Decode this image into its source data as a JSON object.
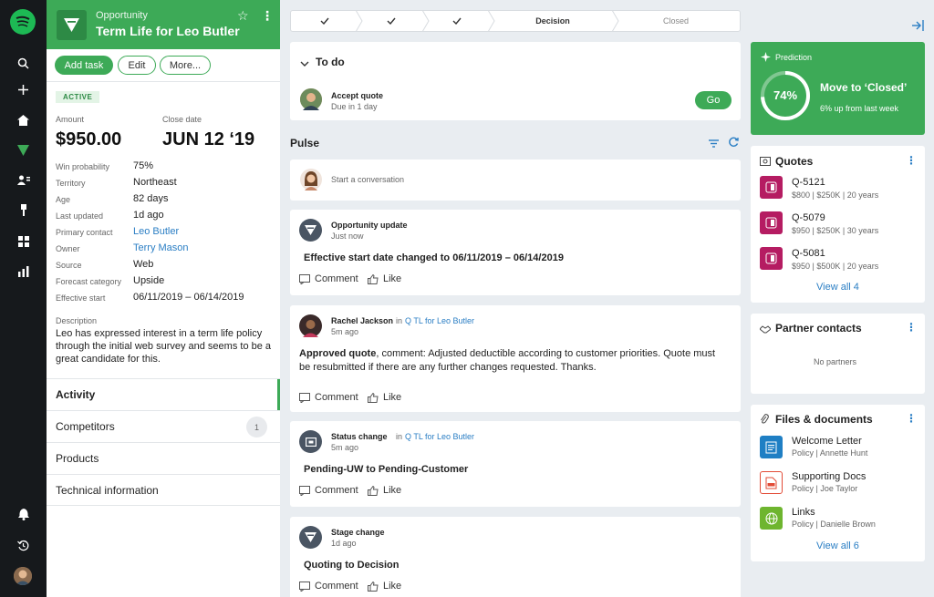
{
  "rail": {
    "icons": [
      "spotify-logo-icon",
      "search-icon",
      "plus-icon",
      "home-icon",
      "funnel-icon",
      "contacts-icon",
      "pin-icon",
      "grid-icon",
      "bar-chart-icon",
      "bell-icon",
      "history-icon"
    ]
  },
  "opportunity": {
    "kind": "Opportunity",
    "name": "Term Life for Leo Butler",
    "actions": {
      "add_task": "Add task",
      "edit": "Edit",
      "more": "More..."
    },
    "status": "ACTIVE",
    "amount_label": "Amount",
    "amount": "$950.00",
    "close_date_label": "Close date",
    "close_date": "JUN 12 ‘19",
    "fields": [
      {
        "label": "Win probability",
        "value": "75%"
      },
      {
        "label": "Territory",
        "value": "Northeast"
      },
      {
        "label": "Age",
        "value": "82 days"
      },
      {
        "label": "Last updated",
        "value": "1d ago"
      },
      {
        "label": "Primary contact",
        "value": "Leo Butler"
      },
      {
        "label": "Owner",
        "value": "Terry Mason"
      },
      {
        "label": "Source",
        "value": "Web"
      },
      {
        "label": "Forecast category",
        "value": "Upside"
      },
      {
        "label": "Effective start",
        "value": "06/11/2019 – 06/14/2019"
      }
    ],
    "description_label": "Description",
    "description": "Leo has expressed interest in a term life policy through the initial web survey and seems to be a great candidate for this.",
    "nav": [
      {
        "label": "Activity"
      },
      {
        "label": "Competitors",
        "count": "1"
      },
      {
        "label": "Products"
      },
      {
        "label": "Technical information"
      }
    ]
  },
  "stages": {
    "current": "Decision",
    "next": "Closed"
  },
  "todo": {
    "title": "To do",
    "task": "Accept quote",
    "due": "Due in 1 day",
    "go": "Go"
  },
  "pulse": {
    "title": "Pulse",
    "placeholder": "Start a conversation",
    "comment": "Comment",
    "like": "Like",
    "items": [
      {
        "title": "Opportunity update",
        "time": "Just now",
        "body": "Effective start date changed to 06/11/2019 – 06/14/2019"
      },
      {
        "title": "Rachel Jackson",
        "in": "in",
        "ref": "Q TL for Leo Butler",
        "time": "5m ago",
        "body_strong": "Approved quote",
        "body": ", comment: Adjusted deductible according to customer priorities. Quote must be resubmitted if there are any further changes requested. Thanks."
      },
      {
        "title": "Status change",
        "in": "in",
        "ref": "Q TL for Leo Butler",
        "time": "5m ago",
        "body": "Pending-UW to Pending-Customer"
      },
      {
        "title": "Stage change",
        "time": "1d ago",
        "body": "Quoting to Decision"
      }
    ]
  },
  "prediction": {
    "label": "Prediction",
    "percent": "74%",
    "fraction": 0.74,
    "headline": "Move to ‘Closed’",
    "sub": "6% up from last week"
  },
  "quotes": {
    "title": "Quotes",
    "items": [
      {
        "id": "Q-5121",
        "detail": "$800 | $250K | 20 years"
      },
      {
        "id": "Q-5079",
        "detail": "$950 | $250K | 30 years"
      },
      {
        "id": "Q-5081",
        "detail": "$950 | $500K | 20 years"
      }
    ],
    "view_all": "View all 4"
  },
  "partners": {
    "title": "Partner contacts",
    "empty": "No partners"
  },
  "files": {
    "title": "Files & documents",
    "items": [
      {
        "name": "Welcome Letter",
        "detail": "Policy | Annette Hunt"
      },
      {
        "name": "Supporting Docs",
        "detail": "Policy | Joe Taylor"
      },
      {
        "name": "Links",
        "detail": "Policy | Danielle Brown"
      }
    ],
    "view_all": "View all 6"
  },
  "colors": {
    "accent": "#3daa57",
    "link": "#2a7ec4",
    "quote": "#b51c62",
    "rail": "#16191c"
  }
}
